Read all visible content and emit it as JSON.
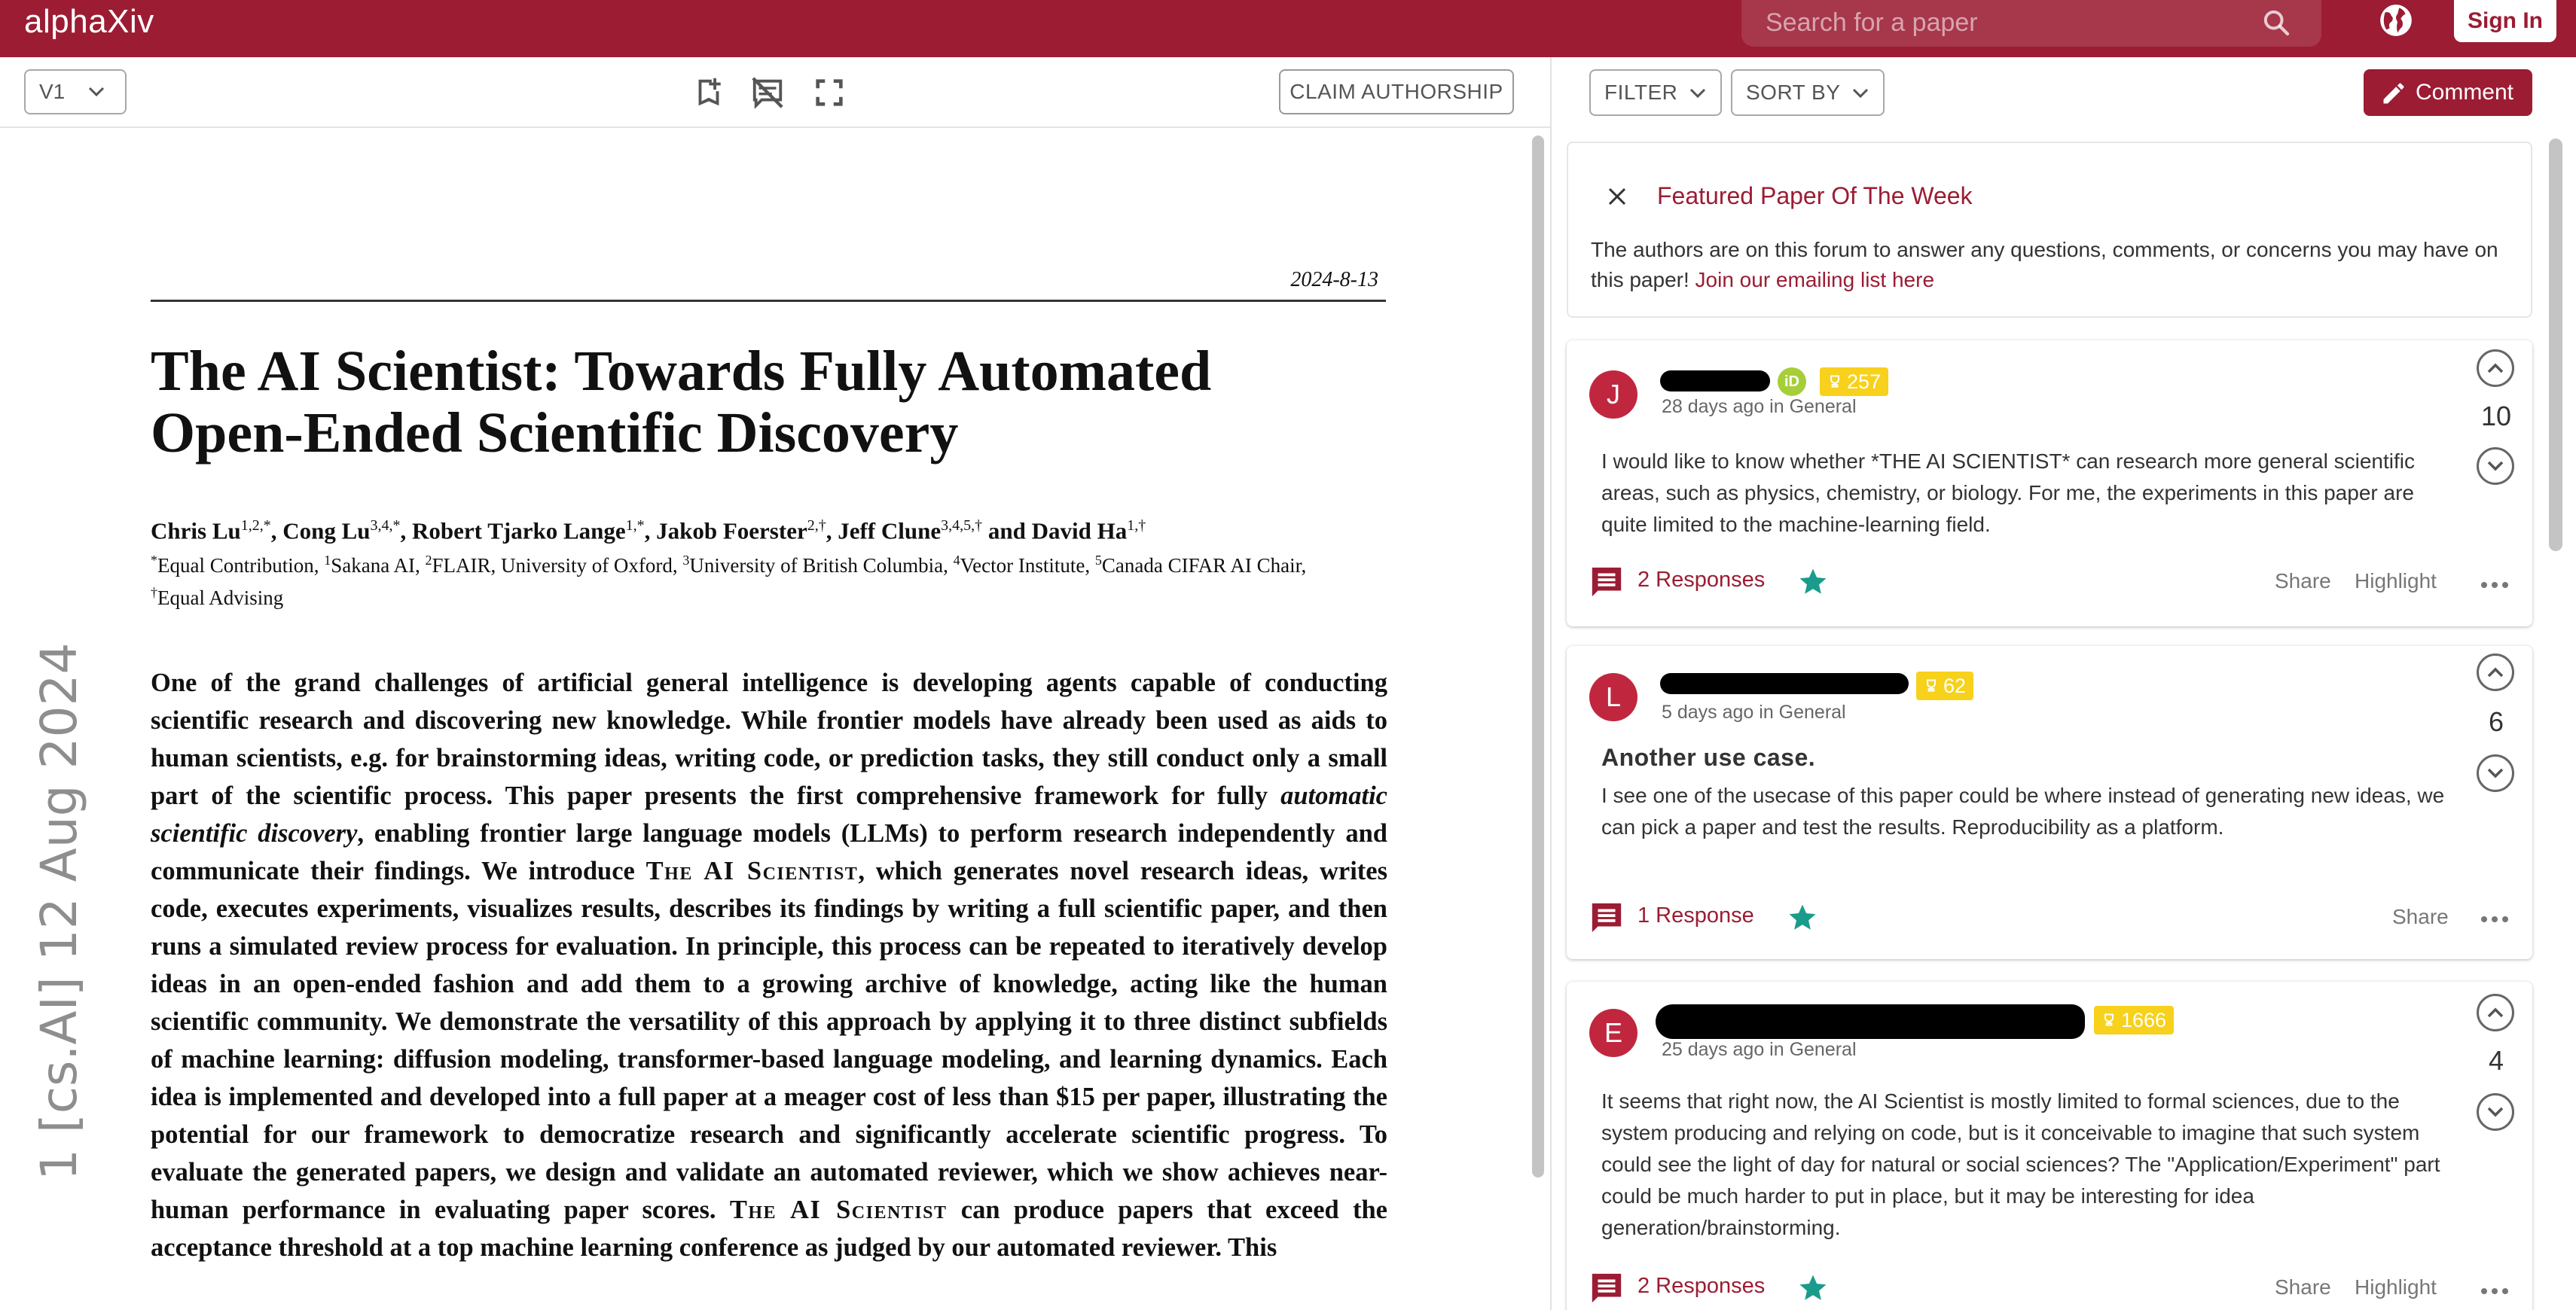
{
  "header": {
    "logo": "alphaXiv",
    "search_placeholder": "Search for a paper",
    "signin_label": "Sign In",
    "brand_color": "#9b1c33"
  },
  "toolbar": {
    "version": "V1",
    "claim_label": "CLAIM AUTHORSHIP",
    "icons": [
      "bookmark-add-icon",
      "comments-off-icon",
      "fullscreen-icon"
    ]
  },
  "paper": {
    "date": "2024-8-13",
    "title_line1": "The AI Scientist: Towards Fully Automated",
    "title_line2": "Open-Ended Scientific Discovery",
    "authors": [
      {
        "name": "Chris Lu",
        "sup": "1,2,*",
        "sep": ", "
      },
      {
        "name": "Cong Lu",
        "sup": "3,4,*",
        "sep": ", "
      },
      {
        "name": "Robert Tjarko Lange",
        "sup": "1,*",
        "sep": ", "
      },
      {
        "name": "Jakob Foerster",
        "sup": "2,†",
        "sep": ", "
      },
      {
        "name": "Jeff Clune",
        "sup": "3,4,5,†",
        "sep": " and "
      },
      {
        "name": "David Ha",
        "sup": "1,†",
        "sep": ""
      }
    ],
    "affiliations": [
      {
        "sup": "*",
        "text": "Equal Contribution, "
      },
      {
        "sup": "1",
        "text": "Sakana AI, "
      },
      {
        "sup": "2",
        "text": "FLAIR, University of Oxford, "
      },
      {
        "sup": "3",
        "text": "University of British Columbia, "
      },
      {
        "sup": "4",
        "text": "Vector Institute, "
      },
      {
        "sup": "5",
        "text": "Canada CIFAR AI Chair, "
      },
      {
        "sup": "†",
        "text": "Equal Advising"
      }
    ],
    "abstract_parts": [
      {
        "t": "One of the grand challenges of artificial general intelligence is developing agents capable of conducting scientific research and discovering new knowledge. While frontier models have already been used as aids to human scientists, e.g. for brainstorming ideas, writing code, or prediction tasks, they still conduct only a small part of the scientific process. This paper presents the first comprehensive framework for fully "
      },
      {
        "t": "automatic scientific discovery",
        "style": "italic"
      },
      {
        "t": ", enabling frontier large language models (LLMs) to perform research independently and communicate their findings. We introduce "
      },
      {
        "t": "The AI Scientist",
        "style": "smallcaps"
      },
      {
        "t": ", which generates novel research ideas, writes code, executes experiments, visualizes results, describes its findings by writing a full scientific paper, and then runs a simulated review process for evaluation. In principle, this process can be repeated to iteratively develop ideas in an open-ended fashion and add them to a growing archive of knowledge, acting like the human scientific community. We demonstrate the versatility of this approach by applying it to three distinct subfields of machine learning: diffusion modeling, transformer-based language modeling, and learning dynamics. Each idea is implemented and developed into a full paper at a meager cost of less than $15 per paper, illustrating the potential for our framework to democratize research and significantly accelerate scientific progress. To evaluate the generated papers, we design and validate an automated reviewer, which we show achieves near-human performance in evaluating paper scores. "
      },
      {
        "t": "The AI Scientist",
        "style": "smallcaps"
      },
      {
        "t": " can produce papers that exceed the acceptance threshold at a top machine learning conference as judged by our automated reviewer. This"
      }
    ],
    "arxiv_stamp": "1  [cs.AI]  12 Aug 2024"
  },
  "sidebar": {
    "filter_label": "FILTER",
    "sort_label": "SORT BY",
    "comment_label": "Comment",
    "featured": {
      "title": "Featured Paper Of The Week",
      "text": "The authors are on this forum to answer any questions, comments, or concerns you may have on this paper! ",
      "link": "Join our emailing list here"
    },
    "comments": [
      {
        "initial": "J",
        "badge": "257",
        "meta": "28 days ago in General",
        "title": "",
        "body": "I would like to know whether *THE AI SCIENTIST* can research more general scientific areas, such as physics, chemistry, or biology. For me, the experiments in this paper are quite limited to the machine-learning field.",
        "responses": "2 Responses",
        "share": "Share",
        "highlight": "Highlight",
        "votes": "10"
      },
      {
        "initial": "L",
        "badge": "62",
        "meta": "5 days ago in General",
        "title": "Another use case.",
        "body": "I see one of the usecase of this paper could be where instead of generating new ideas, we can pick a paper and test the results. Reproducibility as a platform.",
        "responses": "1 Response",
        "share": "Share",
        "highlight": "",
        "votes": "6"
      },
      {
        "initial": "E",
        "badge": "1666",
        "meta": "25 days ago in General",
        "title": "",
        "body": "It seems that right now, the AI Scientist is mostly limited to formal sciences, due to the system producing and relying on code, but is it conceivable to imagine that such system could see the light of day for natural or social sciences? The \"Application/Experiment\" part could be much harder to put in place, but it may be interesting for idea generation/brainstorming.",
        "responses": "2 Responses",
        "share": "Share",
        "highlight": "Highlight",
        "votes": "4"
      }
    ]
  }
}
